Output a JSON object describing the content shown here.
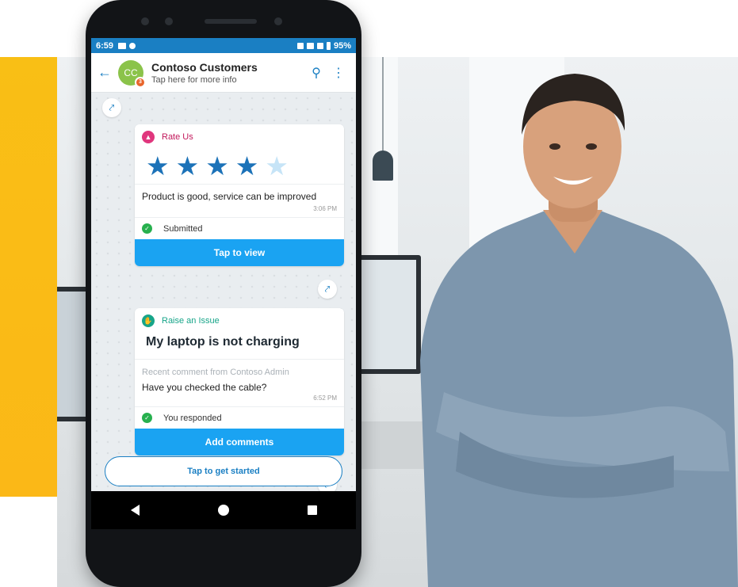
{
  "status_bar": {
    "time": "6:59",
    "battery": "95%"
  },
  "header": {
    "avatar_initials": "CC",
    "avatar_badge": "3",
    "title": "Contoso Customers",
    "subtitle": "Tap here for more info"
  },
  "rate_card": {
    "type_label": "Rate Us",
    "rating": 4,
    "rating_max": 5,
    "comment": "Product is good, service can be improved",
    "time": "3:06 PM",
    "status": "Submitted",
    "action": "Tap to view"
  },
  "issue_card": {
    "type_label": "Raise an Issue",
    "title": "My laptop is not charging",
    "recent_label": "Recent comment from Contoso Admin",
    "recent_comment": "Have you checked the cable?",
    "time": "6:52 PM",
    "status": "You responded",
    "action": "Add comments"
  },
  "start_button": "Tap to get started",
  "colors": {
    "accent_yellow": "#f9bf15",
    "brand_blue": "#1a7fc3",
    "button_blue": "#1aa3f2",
    "star_filled": "#1c72b8",
    "star_empty": "#c6e4f7",
    "success_green": "#27b04e"
  }
}
